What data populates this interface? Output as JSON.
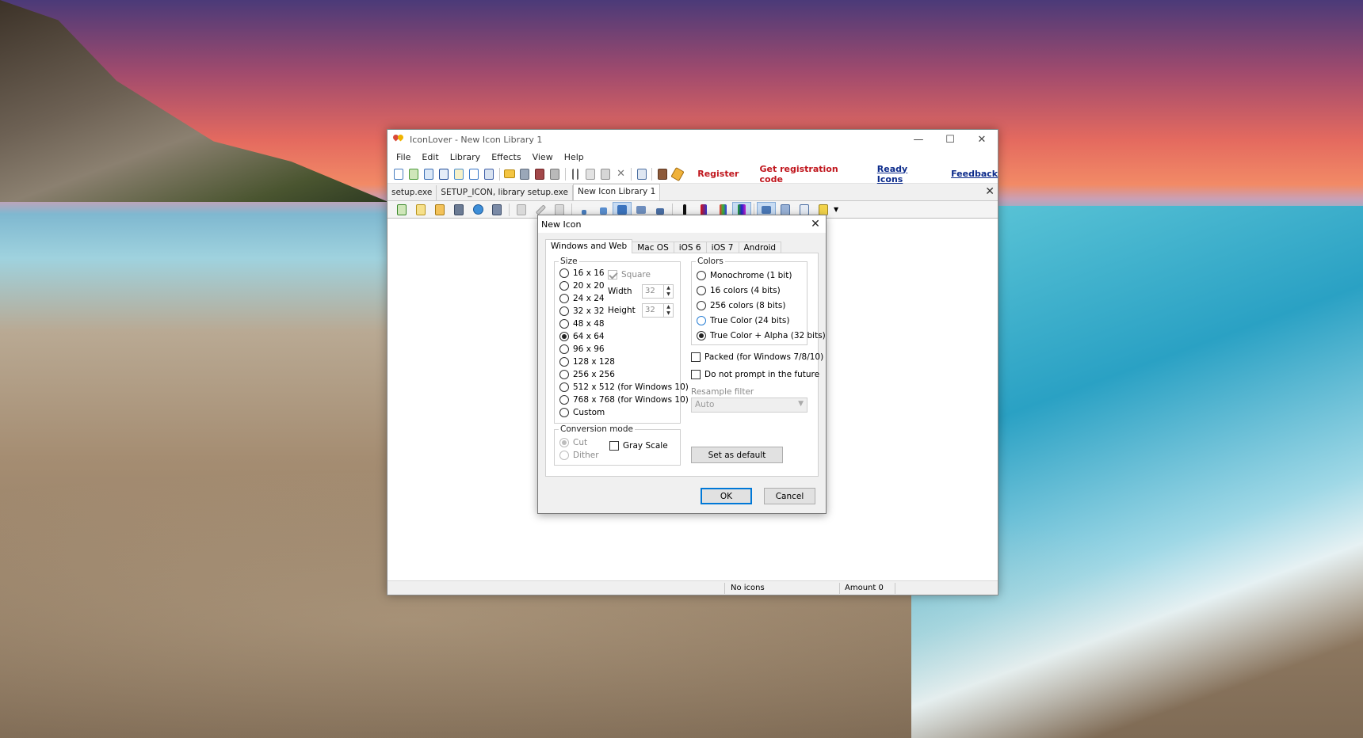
{
  "window": {
    "title": "IconLover - New Icon Library 1",
    "minimize": "—",
    "maximize": "☐",
    "close": "✕"
  },
  "menu": [
    "File",
    "Edit",
    "Library",
    "Effects",
    "View",
    "Help"
  ],
  "links": {
    "register": "Register",
    "get_code": "Get registration code",
    "ready_icons": "Ready Icons",
    "feedback": "Feedback"
  },
  "doc_tabs": [
    "setup.exe",
    "SETUP_ICON, library setup.exe",
    "New Icon Library 1"
  ],
  "doc_tabs_close": "✕",
  "status": {
    "icons": "No icons",
    "amount": "Amount 0"
  },
  "dialog": {
    "title": "New Icon",
    "close": "✕",
    "tabs": [
      "Windows and Web",
      "Mac OS",
      "iOS 6",
      "iOS 7",
      "Android"
    ],
    "size_group": "Size",
    "sizes": [
      "16 x 16",
      "20 x 20",
      "24 x 24",
      "32 x 32",
      "48 x 48",
      "64 x 64",
      "96 x 96",
      "128 x 128",
      "256 x 256",
      "512 x 512 (for Windows 10)",
      "768 x 768 (for Windows 10)",
      "Custom"
    ],
    "selected_size": "64 x 64",
    "square": "Square",
    "width_label": "Width",
    "width_value": "32",
    "height_label": "Height",
    "height_value": "32",
    "colors_group": "Colors",
    "colors": [
      "Monochrome (1 bit)",
      "16 colors (4 bits)",
      "256 colors (8 bits)",
      "True Color (24 bits)",
      "True Color + Alpha (32 bits)"
    ],
    "selected_color": "True Color + Alpha (32 bits)",
    "packed": "Packed (for Windows 7/8/10)",
    "no_prompt": "Do not prompt in the future",
    "resample_label": "Resample filter",
    "resample_value": "Auto",
    "conversion_group": "Conversion mode",
    "cut": "Cut",
    "dither": "Dither",
    "gray_scale": "Gray Scale",
    "set_default": "Set as default",
    "ok": "OK",
    "cancel": "Cancel"
  }
}
